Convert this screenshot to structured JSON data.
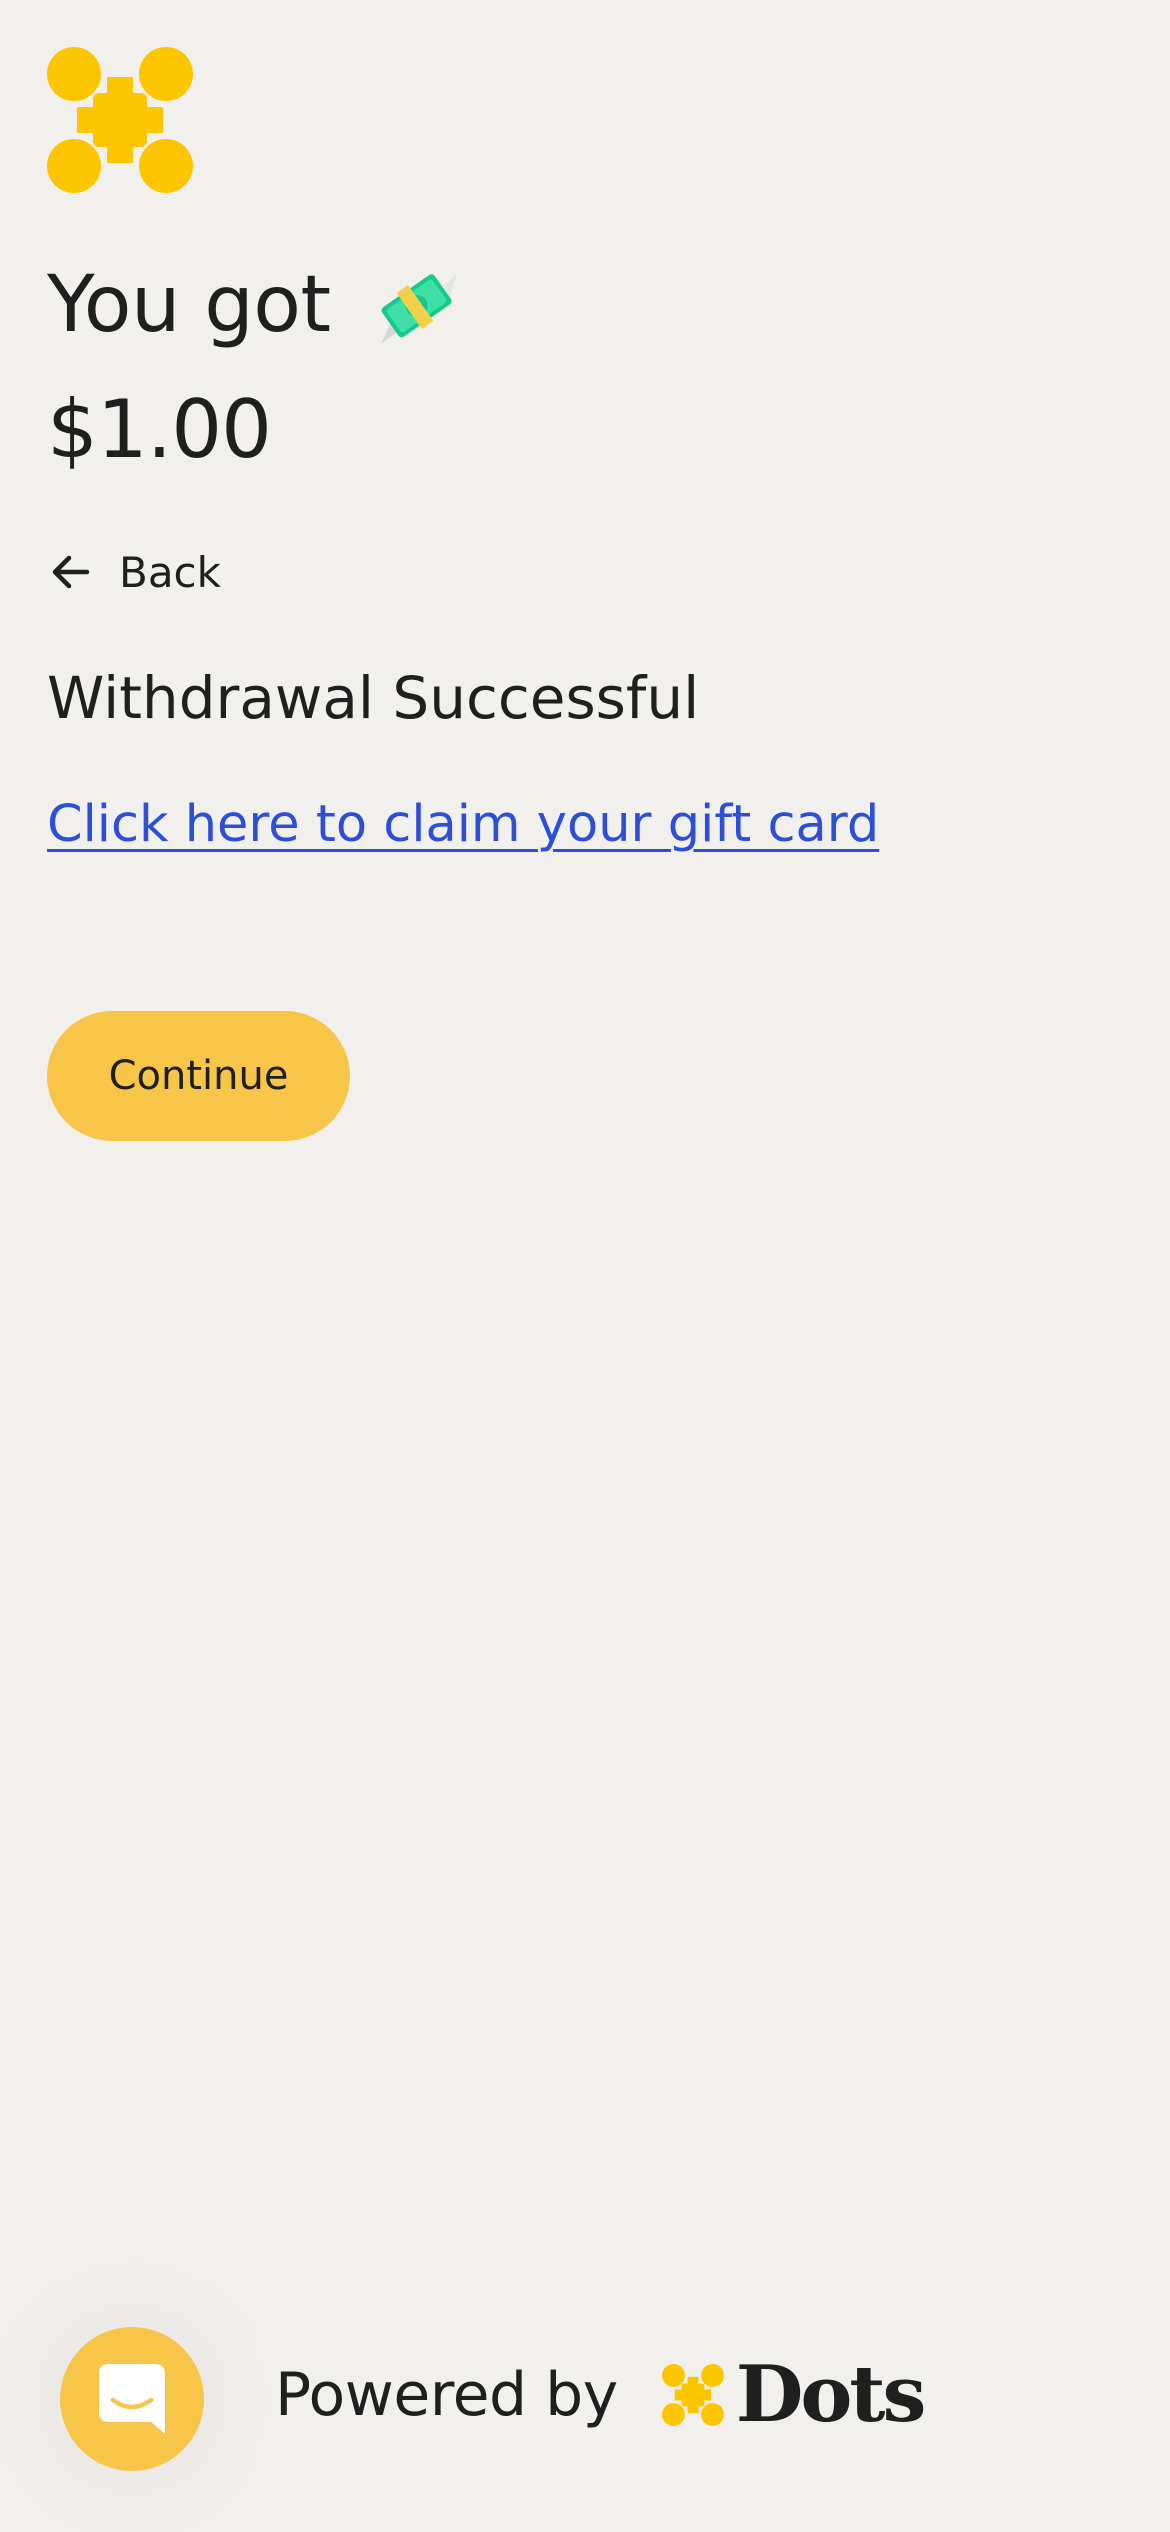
{
  "header": {
    "logo_icon": "dots-logo-icon",
    "brand_color": "#fdc400"
  },
  "main": {
    "headline": "You got",
    "headline_icon": "money-with-wings-icon",
    "amount": "$1.00",
    "back_label": "Back",
    "status_text": "Withdrawal Successful",
    "claim_link_text": "Click here to claim your gift card",
    "continue_label": "Continue"
  },
  "footer": {
    "powered_by": "Powered by",
    "brand_name": "Dots",
    "chat_icon": "chat-bubble-icon"
  },
  "colors": {
    "background": "#f2f0ec",
    "accent": "#f7c548",
    "link": "#2d4fd6",
    "text": "#1f1f1f"
  }
}
